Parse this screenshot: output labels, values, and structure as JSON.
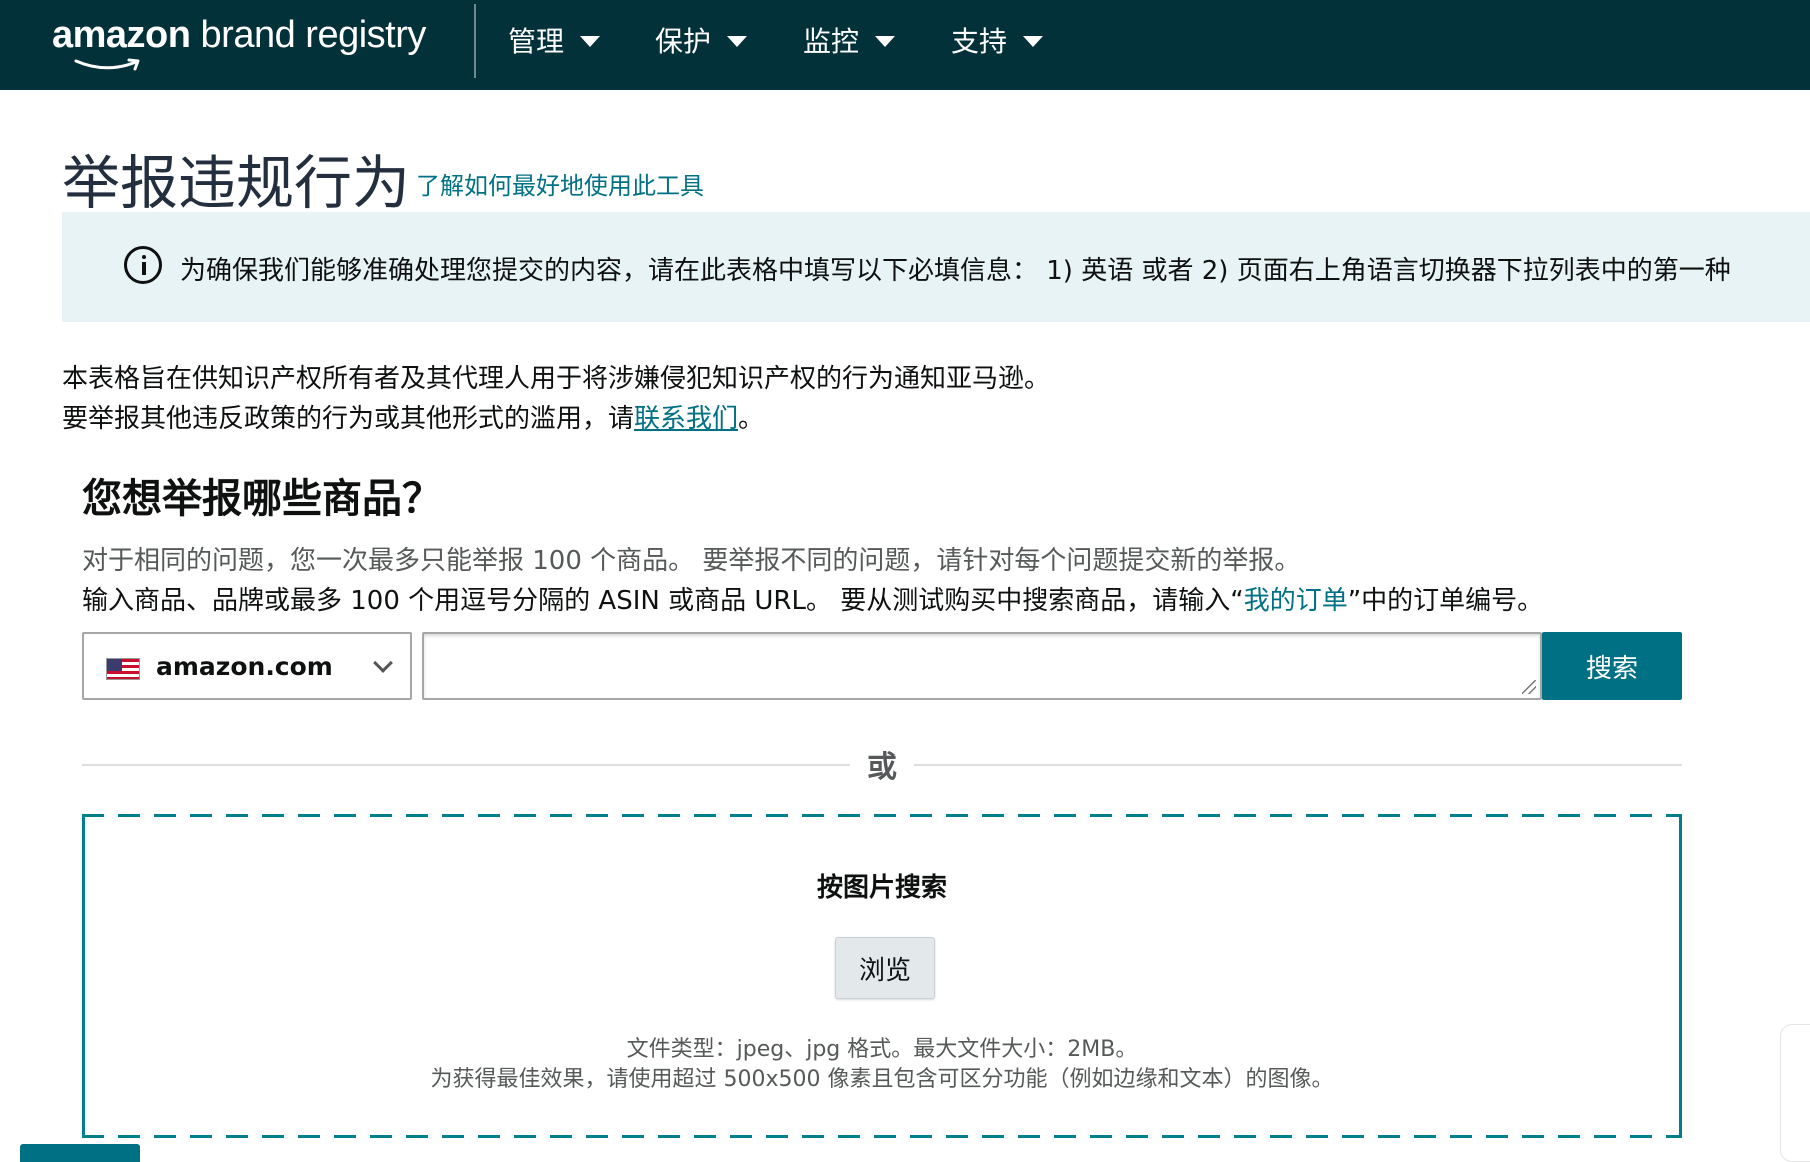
{
  "header": {
    "logo_bold": "amazon",
    "logo_rest": " brand registry",
    "nav": [
      {
        "label": "管理"
      },
      {
        "label": "保护"
      },
      {
        "label": "监控"
      },
      {
        "label": "支持"
      }
    ]
  },
  "page": {
    "title": "举报违规行为",
    "learn_link": "了解如何最好地使用此工具"
  },
  "banner": {
    "text": "为确保我们能够准确处理您提交的内容，请在此表格中填写以下必填信息： 1) 英语 或者 2) 页面右上角语言切换器下拉列表中的第一种"
  },
  "intro": {
    "line1": "本表格旨在供知识产权所有者及其代理人用于将涉嫌侵犯知识产权的行为通知亚马逊。",
    "line2_prefix": "要举报其他违反政策的行为或其他形式的滥用，请",
    "line2_link": "联系我们",
    "line2_suffix": "。"
  },
  "product_search": {
    "heading": "您想举报哪些商品？",
    "note1": "对于相同的问题，您一次最多只能举报 100 个商品。 要举报不同的问题，请针对每个问题提交新的举报。",
    "note2_prefix": "输入商品、品牌或最多 100 个用逗号分隔的 ASIN 或商品 URL。 要从测试购买中搜索商品，请输入“",
    "note2_link": "我的订单",
    "note2_suffix": "”中的订单编号。",
    "marketplace": "amazon.com",
    "marketplace_flag": "us-flag-icon",
    "search_value": "",
    "search_button": "搜索",
    "or_label": "或"
  },
  "image_search": {
    "title": "按图片搜索",
    "browse_button": "浏览",
    "note1": "文件类型：jpeg、jpg 格式。最大文件大小：2MB。",
    "note2": "为获得最佳效果，请使用超过 500x500 像素且包含可区分功能（例如边缘和文本）的图像。"
  },
  "colors": {
    "header_bg": "#02313a",
    "accent": "#007185",
    "banner_bg": "#e7f3f4",
    "dashed_border": "#00808e"
  }
}
